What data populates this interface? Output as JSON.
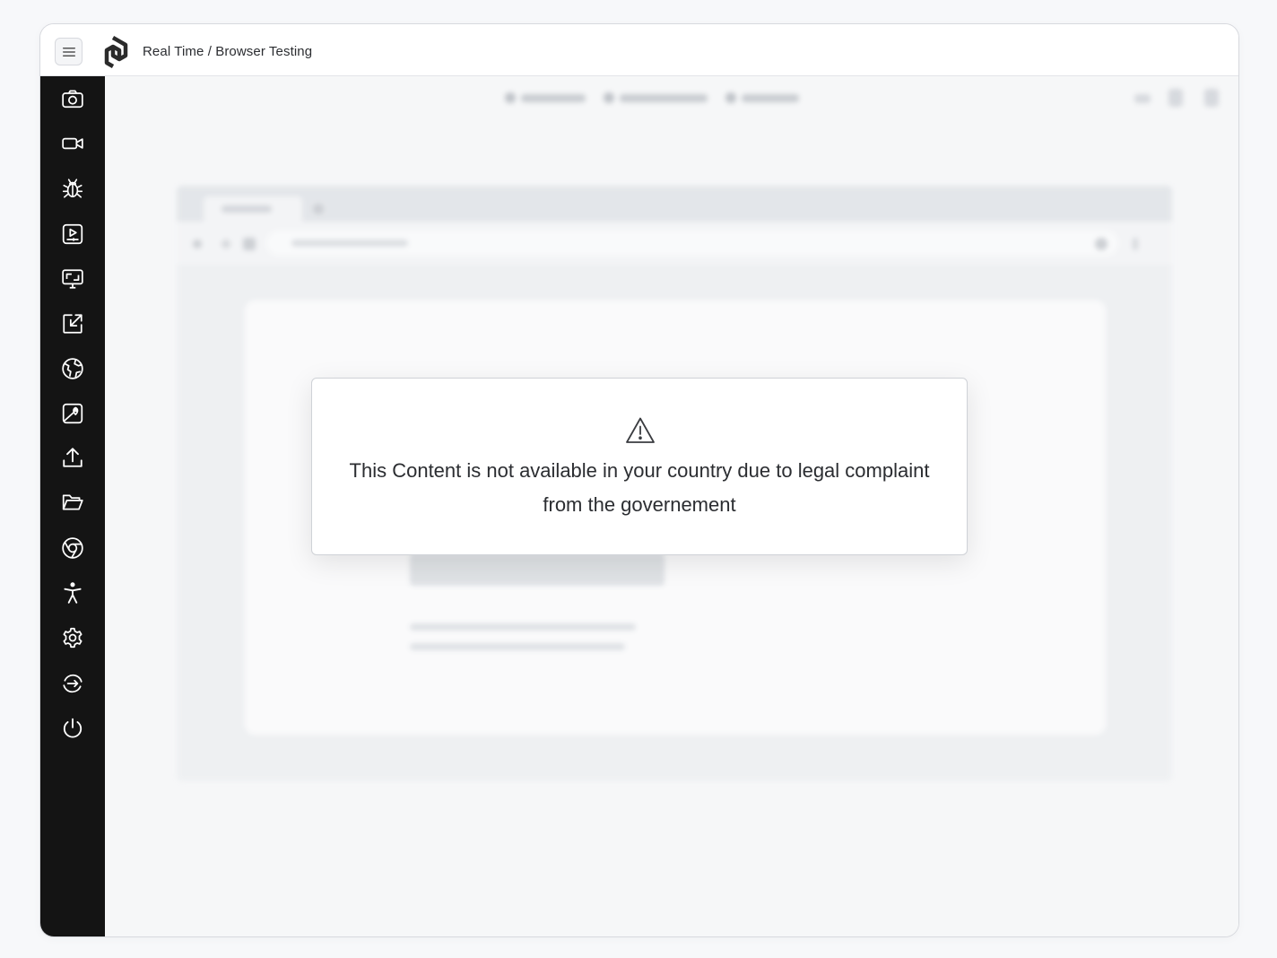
{
  "header": {
    "title": "Real Time / Browser Testing",
    "menu_icon": "hamburger-icon",
    "logo_icon": "lambdatest-logo-icon"
  },
  "sidebar": {
    "items": [
      {
        "icon": "camera-icon"
      },
      {
        "icon": "video-icon"
      },
      {
        "icon": "bug-icon"
      },
      {
        "icon": "play-recording-icon"
      },
      {
        "icon": "screen-resolution-icon"
      },
      {
        "icon": "resize-arrow-icon"
      },
      {
        "icon": "globe-icon"
      },
      {
        "icon": "geolocation-icon"
      },
      {
        "icon": "upload-icon"
      },
      {
        "icon": "folder-icon"
      },
      {
        "icon": "chrome-icon"
      },
      {
        "icon": "accessibility-icon"
      },
      {
        "icon": "settings-icon"
      },
      {
        "icon": "switch-session-icon"
      },
      {
        "icon": "power-icon"
      }
    ]
  },
  "modal": {
    "icon": "warning-icon",
    "message": "This Content is not available in your country due to legal complaint from the governement"
  },
  "colors": {
    "sidebar_bg": "#141414",
    "main_bg": "#f6f7f8",
    "modal_border": "#cfd2d7",
    "text": "#2b2d31"
  }
}
